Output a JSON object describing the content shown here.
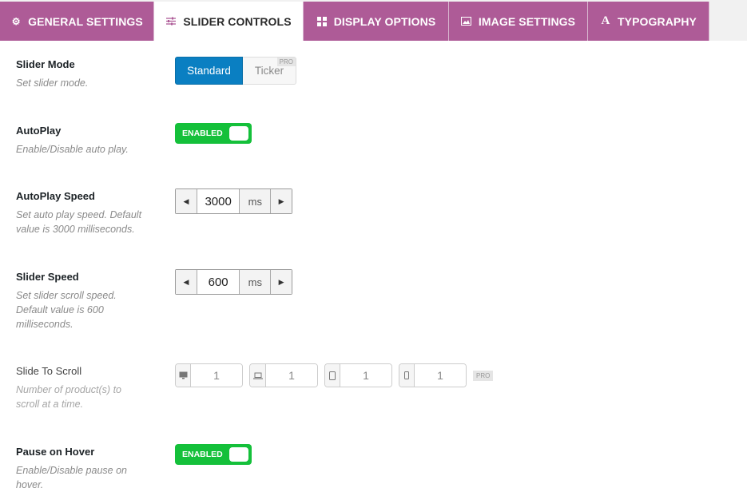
{
  "tabs": [
    {
      "label": "GENERAL SETTINGS",
      "icon": "gear-icon",
      "active": false
    },
    {
      "label": "SLIDER CONTROLS",
      "icon": "sliders-icon",
      "active": true
    },
    {
      "label": "DISPLAY OPTIONS",
      "icon": "grid-icon",
      "active": false
    },
    {
      "label": "IMAGE SETTINGS",
      "icon": "image-icon",
      "active": false
    },
    {
      "label": "TYPOGRAPHY",
      "icon": "font-icon",
      "active": false
    }
  ],
  "colors": {
    "tab_bg": "#ae5b97",
    "primary": "#0a7fc2",
    "toggle_on": "#14c03a"
  },
  "fields": {
    "slider_mode": {
      "label": "Slider Mode",
      "desc": "Set slider mode.",
      "options": [
        "Standard",
        "Ticker"
      ],
      "selected": "Standard",
      "pro_badge": "PRO"
    },
    "autoplay": {
      "label": "AutoPlay",
      "desc": "Enable/Disable auto play.",
      "state": "ENABLED"
    },
    "autoplay_speed": {
      "label": "AutoPlay Speed",
      "desc": "Set auto play speed. Default value is 3000 milliseconds.",
      "value": "3000",
      "unit": "ms"
    },
    "slider_speed": {
      "label": "Slider Speed",
      "desc": "Set slider scroll speed. Default value is 600 milliseconds.",
      "value": "600",
      "unit": "ms"
    },
    "slide_to_scroll": {
      "label": "Slide To Scroll",
      "desc": "Number of product(s) to scroll at a time.",
      "desktop": "1",
      "laptop": "1",
      "tablet": "1",
      "mobile": "1",
      "pro_badge": "PRO"
    },
    "pause_on_hover": {
      "label": "Pause on Hover",
      "desc": "Enable/Disable pause on hover.",
      "state": "ENABLED"
    }
  }
}
